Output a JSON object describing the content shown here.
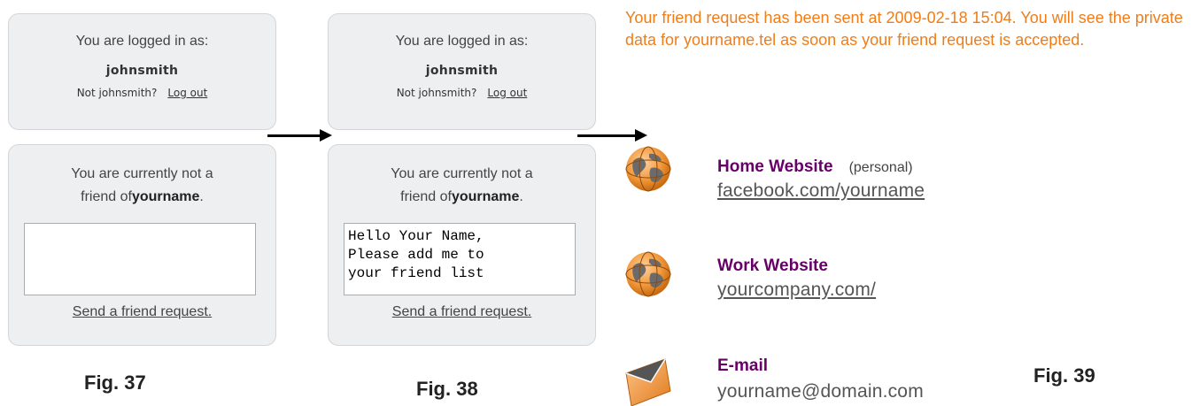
{
  "fig37": {
    "login": {
      "title": "You are logged in as:",
      "username": "johnsmith",
      "not_user": "Not johnsmith?",
      "logout": "Log out"
    },
    "friend": {
      "line1": "You are currently not a",
      "line2_prefix": "friend of",
      "name": "yourname",
      "line2_suffix": ".",
      "message": "",
      "send_label": "Send a friend request."
    },
    "caption": "Fig. 37"
  },
  "fig38": {
    "login": {
      "title": "You are logged in as:",
      "username": "johnsmith",
      "not_user": "Not johnsmith?",
      "logout": "Log out"
    },
    "friend": {
      "line1": "You are currently not a",
      "line2_prefix": "friend of",
      "name": "yourname",
      "line2_suffix": ".",
      "message": "Hello Your Name,\nPlease add me to\nyour friend list",
      "send_label": "Send a friend request."
    },
    "caption": "Fig. 38"
  },
  "fig39": {
    "status": "Your friend request has been sent at 2009-02-18 15:04. You will see the private data for yourname.tel as soon as your friend request is accepted.",
    "entries": [
      {
        "icon": "globe-icon",
        "title": "Home Website",
        "tag": "(personal)",
        "value": "facebook.com/yourname"
      },
      {
        "icon": "globe-icon",
        "title": "Work Website",
        "tag": "",
        "value": "yourcompany.com/"
      },
      {
        "icon": "envelope-icon",
        "title": "E-mail",
        "tag": "",
        "value": "yourname@domain.com"
      }
    ],
    "caption": "Fig. 39"
  },
  "colors": {
    "status": "#ef7d19",
    "entry_title": "#660066",
    "panel_bg": "#eeeff1",
    "icon_orange": "#f39a3c"
  }
}
